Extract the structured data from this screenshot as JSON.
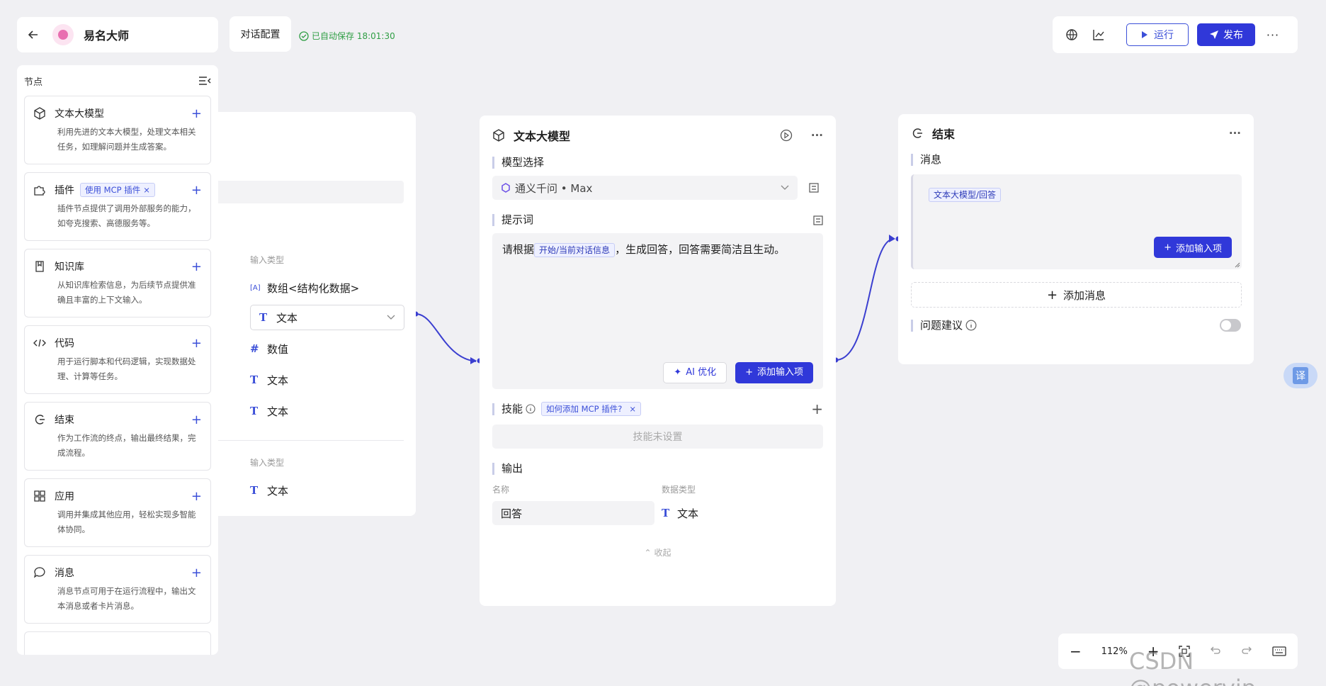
{
  "topbar": {
    "app_title": "易名大师",
    "config_label": "对话配置",
    "autosave_text": "已自动保存 18:01:30",
    "run_label": "运行",
    "publish_label": "发布"
  },
  "sidebar": {
    "header": "节点",
    "items": [
      {
        "name": "文本大模型",
        "desc": "利用先进的文本大模型，处理文本相关任务，如理解问题并生成答案。",
        "icon": "cube-icon"
      },
      {
        "name": "插件",
        "tag": "使用 MCP 插件",
        "desc": "插件节点提供了调用外部服务的能力，如夸克搜索、高德服务等。",
        "icon": "puzzle-icon"
      },
      {
        "name": "知识库",
        "desc": "从知识库检索信息，为后续节点提供准确且丰富的上下文输入。",
        "icon": "book-icon"
      },
      {
        "name": "代码",
        "desc": "用于运行脚本和代码逻辑，实现数据处理、计算等任务。",
        "icon": "code-icon"
      },
      {
        "name": "结束",
        "desc": "作为工作流的终点，输出最终结果，完成流程。",
        "icon": "end-icon"
      },
      {
        "name": "应用",
        "desc": "调用并集成其他应用，轻松实现多智能体协同。",
        "icon": "grid-icon"
      },
      {
        "name": "消息",
        "desc": "消息节点可用于在运行流程中，输出文本消息或者卡片消息。",
        "icon": "chat-icon"
      }
    ]
  },
  "start_node": {
    "col_header_1": "输入类型",
    "types": [
      "数组<结构化数据>",
      "文本",
      "数值",
      "文本",
      "文本"
    ],
    "col_header_2": "输入类型",
    "types2": [
      "文本"
    ]
  },
  "llm_node": {
    "title": "文本大模型",
    "model_label": "模型选择",
    "model_value": "通义千问 • Max",
    "prompt_label": "提示词",
    "prompt_before": "请根据",
    "prompt_tag": "开始/当前对话信息",
    "prompt_after": "，生成回答，回答需要简洁且生动。",
    "ai_optimize": "AI 优化",
    "add_input": "添加输入项",
    "skills_label": "技能",
    "skills_tag": "如何添加 MCP 插件?",
    "skills_empty": "技能未设置",
    "output_label": "输出",
    "col_name": "名称",
    "col_type": "数据类型",
    "output_name": "回答",
    "output_type": "文本",
    "collapse": "收起"
  },
  "end_node": {
    "title": "结束",
    "message_label": "消息",
    "message_tag": "文本大模型/回答",
    "add_input": "添加输入项",
    "add_message": "添加消息",
    "suggest_label": "问题建议"
  },
  "zoom": {
    "level": "112%"
  },
  "translate_label": "译",
  "watermark": "CSDN @powervip",
  "colors": {
    "accent": "#3038d9",
    "edge": "#3b3fd0",
    "autosave": "#2f9e44"
  }
}
